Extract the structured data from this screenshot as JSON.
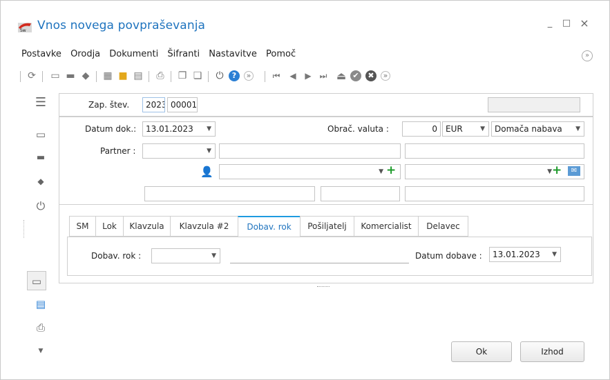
{
  "window": {
    "title": "Vnos novega povpraševanja",
    "minimize": "_",
    "maximize": "□",
    "close": "×"
  },
  "menu": {
    "items": [
      "Postavke",
      "Orodja",
      "Dokumenti",
      "Šifranti",
      "Nastavitve",
      "Pomoč"
    ]
  },
  "toolbar": {
    "icons": [
      "refresh-icon",
      "new-doc-icon",
      "open-folder-icon",
      "eraser-icon",
      "calculator-icon",
      "lock-icon",
      "grid-icon",
      "print-icon",
      "copy-icon",
      "paste-icon",
      "power-icon",
      "help-icon",
      "more-icon",
      "first-icon",
      "prev-icon",
      "next-icon",
      "last-icon",
      "eject-icon",
      "check-icon",
      "cancel-icon",
      "more-icon"
    ]
  },
  "header": {
    "zap_label": "Zap. štev.",
    "year_value": "2023",
    "number_value": "00001"
  },
  "form": {
    "datum_label": "Datum dok.:",
    "datum_value": "13.01.2023",
    "valuta_label": "Obrač. valuta :",
    "valuta_amount": "0",
    "valuta_currency": "EUR",
    "nabava_value": "Domača nabava",
    "partner_label": "Partner :"
  },
  "tabs": [
    "SM",
    "Lok",
    "Klavzula",
    "Klavzula #2",
    "Dobav. rok",
    "Pošiljatelj",
    "Komercialist",
    "Delavec"
  ],
  "active_tab": "Dobav. rok",
  "panel": {
    "rok_label": "Dobav. rok :",
    "datum_dobave_label": "Datum dobave :",
    "datum_dobave_value": "13.01.2023"
  },
  "buttons": {
    "ok": "Ok",
    "exit": "Izhod"
  },
  "colors": {
    "accent": "#1e73be",
    "tab_active_border": "#1e9be0",
    "plus_green": "#1d9a2a"
  }
}
